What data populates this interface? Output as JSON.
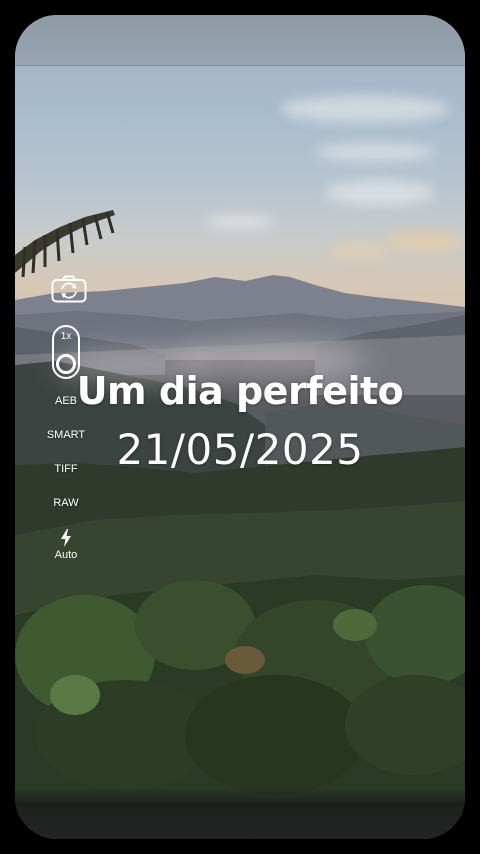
{
  "overlay": {
    "title": "Um dia perfeito",
    "date": "21/05/2025"
  },
  "camera_controls": {
    "switch_camera_icon": "camera-rotate-icon",
    "zoom_label": "1x",
    "options": [
      "AEB",
      "SMART",
      "TIFF",
      "RAW"
    ],
    "flash_icon": "flash-bolt-icon",
    "flash_label": "Auto"
  },
  "colors": {
    "text": "#ffffff",
    "background": "#000000"
  }
}
